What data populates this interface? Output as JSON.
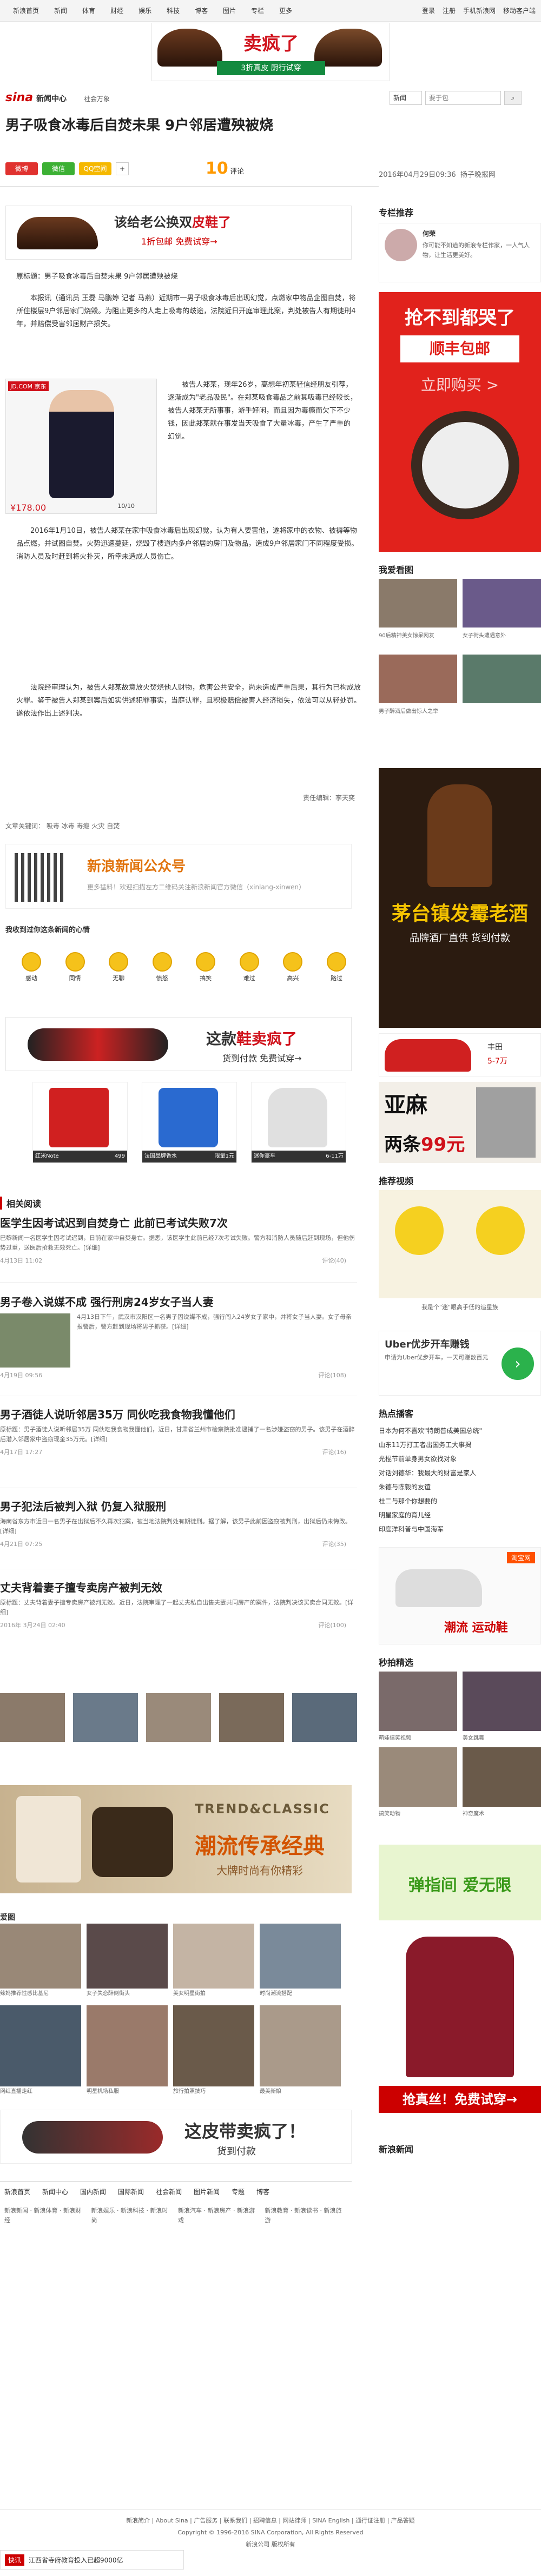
{
  "topnav": {
    "items": [
      "新浪首页",
      "新闻",
      "体育",
      "财经",
      "娱乐",
      "科技",
      "博客",
      "图片",
      "专栏",
      "更多"
    ],
    "right": [
      "登录",
      "注册",
      "手机新浪网",
      "移动客户端"
    ]
  },
  "top_ad": {
    "headline": "卖疯了",
    "sub": "3折真皮 厨行试穿"
  },
  "header": {
    "logo": "sina新闻中心",
    "logo_sub": "新闻中心",
    "channel": "社会万象",
    "search_select": "新闻",
    "search_placeholder": "要于包"
  },
  "article": {
    "title": "男子吸食冰毒后自焚未果 9户邻居遭殃被烧",
    "share_buttons": [
      "微博",
      "微信",
      "QQ空间"
    ],
    "comment_count": "10",
    "comment_label": "评论",
    "date": "2016年04月29日09:36",
    "source": "扬子晚报网",
    "ad": {
      "headline_pre": "该给老公换双",
      "headline_hl": "皮鞋了",
      "sub": "1折包邮 免费试穿→"
    },
    "paragraphs": [
      "原标题：男子吸食冰毒后自焚未果 9户邻居遭殃被烧",
      "本报讯（通讯员 王磊 马鹏婷 记者 马燕）近期市一男子吸食冰毒后出现幻觉，点燃家中物品企图自焚，将所住楼层9户邻居家门烧毁。为阻止更多的人走上吸毒的歧途，法院近日开庭审理此案，判处被告人有期徒刑4年，并赔偿受害邻居财产损失。",
      "被告人郑某，现年26岁，高想年初某轻信经朋友引荐，逐渐成为\"老品吸民\"。在郑某吸食毒品之前其吸毒已经较长，被告人郑某无所事事，游手好闲，而且因为毒瘾而欠下不少钱，因此郑某就在事发当天吸食了大量冰毒，产生了严重的幻觉。",
      "2016年1月10日，被告人郑某在家中吸食冰毒后出现幻觉，认为有人要害他，遂将家中的衣物、被褥等物品点燃，并试图自焚。火势迅速蔓延，烧毁了楼道内多户邻居的房门及物品，造成9户邻居家门不同程度受损。消防人员及时赶到将火扑灭，所幸未造成人员伤亡。",
      "法院经审理认为，被告人郑某故意放火焚烧他人财物，危害公共安全，尚未造成严重后果，其行为已构成放火罪。鉴于被告人郑某到案后如实供述犯罪事实，当庭认罪，且积极赔偿被害人经济损失，依法可以从轻处罚。遂依法作出上述判决。"
    ],
    "jd_ad": {
      "label": "JD.COM 京东",
      "price": "¥178.00",
      "page": "10/10"
    },
    "editor": "责任编辑：李天奕",
    "tags_label": "文章关键词：",
    "tags": [
      "吸毒",
      "冰毒",
      "毒瘾",
      "火灾",
      "自焚"
    ]
  },
  "wechat": {
    "title": "新浪新闻公众号",
    "desc": "更多猛料！欢迎扫描左方二维码关注新浪新闻官方微信（xinlang-xinwen）"
  },
  "mood": {
    "title": "我收到过你这条新闻的心情",
    "items": [
      "感动",
      "同情",
      "无聊",
      "愤怒",
      "搞笑",
      "难过",
      "高兴",
      "路过"
    ]
  },
  "shoe_ad": {
    "headline_pre": "这款",
    "headline_hl": "鞋卖疯了",
    "sub": "货到付款 免费试穿→"
  },
  "products": [
    {
      "name": "红米Note",
      "price": "499"
    },
    {
      "name": "法国品牌香水",
      "price": "限量1元"
    },
    {
      "name": "迷你豪车",
      "price": "6-11万"
    }
  ],
  "related": {
    "title": "相关阅读",
    "items": [
      {
        "headline": "医学生因考试迟到自焚身亡 此前已考试失败7次",
        "summary": "巴黎新闻一名医学生因考试迟到，日前在家中自焚身亡。据悉，该医学生此前已经7次考试失败。警方和消防人员随后赶到现场，但他伤势过重，送医后抢救无效死亡。[详细]",
        "time": "4月13日 11:02",
        "comments": "评论(40)"
      },
      {
        "headline": "男子卷入说媒不成 强行刑房24岁女子当人妻",
        "summary": "4月13日下午，武汉市汉阳区一名男子因说媒不成，强行闯入24岁女子家中，并将女子当人妻。女子母亲报警后，警方赶到现场将男子抓获。[详细]",
        "time": "4月19日 09:56",
        "comments": "评论(108)"
      },
      {
        "headline": "男子酒徒人说听邻居35万 同伙吃我食物我懂他们",
        "summary": "原标题：男子酒徒人说听邻居35万 同伙吃我食物我懂他们，近日，甘肃省兰州市检察院批准逮捕了一名涉嫌盗窃的男子。该男子在酒醉后潜入邻居家中盗窃现金35万元。[详细]",
        "time": "4月17日 17:27",
        "comments": "评论(16)"
      },
      {
        "headline": "男子犯法后被判入狱 仍复入狱服刑",
        "summary": "海南省东方市近日一名男子在出狱后不久再次犯案，被当地法院判处有期徒刑。据了解，该男子此前因盗窃被判刑，出狱后仍未悔改。[详细]",
        "time": "4月21日 07:25",
        "comments": "评论(35)"
      },
      {
        "headline": "丈夫背着妻子擅专卖房产被判无效",
        "summary": "原标题：丈夫背着妻子擅专卖房产被判无效。近日，法院审理了一起丈夫私自出售夫妻共同房产的案件，法院判决该买卖合同无效。[详细]",
        "time": "2016年 3月24日 02:40",
        "comments": "评论(100)"
      }
    ]
  },
  "fashion_ad": {
    "line1": "TREND&CLASSIC",
    "line2": "潮流传承经典",
    "line3": "大牌时尚有你精彩"
  },
  "gallery": {
    "title": "爱图",
    "captions": [
      "辣妈推荐性感比基尼",
      "女子失恋醉倒街头",
      "美女明星街拍",
      "时尚潮流搭配",
      "网红直播走红",
      "明星机场私服",
      "旅行拍照技巧",
      "最美新娘"
    ]
  },
  "shoe_ad2": {
    "headline": "这皮带卖疯了！",
    "sub": "货到付款"
  },
  "footer_links": {
    "tabs": [
      "新浪首页",
      "新闻中心",
      "国内新闻",
      "国际新闻",
      "社会新闻",
      "图片新闻",
      "专题",
      "博客"
    ],
    "cols": [
      "新浪新闻 · 新浪体育 · 新浪财经",
      "新浪娱乐 · 新浪科技 · 新浪时尚",
      "新浪汽车 · 新浪房产 · 新浪游戏",
      "新浪教育 · 新浪读书 · 新浪旅游"
    ]
  },
  "sidebar": {
    "column_title": "专栏推荐",
    "column_author": "何荣",
    "column_desc": "你可能不知道的新浪专栏作家，一人气人物，让生活更美好。",
    "ad1": {
      "t": "抢不到都哭了",
      "b": "顺丰包邮",
      "c": "立即购买 >"
    },
    "watch_title": "我爱看图",
    "watch_caption": [
      "90后精神美女惊呆网友",
      "女子街头遭遇意外",
      "男子醉酒后做出惊人之举"
    ],
    "ad2": {
      "t": "茅台镇发霉老酒",
      "s": "品牌酒厂直供 货到付款"
    },
    "car_ad": {
      "name": "丰田",
      "price": "5-7万"
    },
    "ad3": {
      "t": "亚麻",
      "s_pre": "两条",
      "s_hl": "99元"
    },
    "video_title": "推荐视频",
    "video_caption": "我是个\"迷\"眼高手低的追星族",
    "uber": {
      "t": "Uber优步开车赚钱",
      "s": "申请为Uber优步开车，一天可赚数百元"
    },
    "hot_title": "热点播客",
    "hot_list": [
      "日本为何不喜欢\"特朗普成美国总统\"",
      "山东11万打工者出国务工大事揭",
      "光棍节前单身男女欲找对象",
      "对话刘德华：我最大的财富是家人",
      "朱德与陈毅的友谊",
      "杜二与那个你想要的",
      "明星家庭的育儿经",
      "印度洋科普与中国海军"
    ],
    "taobao": {
      "label": "淘宝网",
      "sub": "潮流 运动鞋"
    },
    "pick_title": "秒拍精选",
    "pick_captions": [
      "萌娃搞笑视频",
      "美女跳舞",
      "搞笑动物",
      "神奇魔术"
    ],
    "ad4": {
      "t": "弹指间 爱无限"
    },
    "ad5": {
      "t": "抢真丝！免费试穿→"
    },
    "news_title": "新浪新闻"
  },
  "footer": {
    "links": [
      "新浪简介",
      "About Sina",
      "广告服务",
      "联系我们",
      "招聘信息",
      "网站律师",
      "SINA English",
      "通行证注册",
      "产品答疑"
    ],
    "copyright": "Copyright © 1996-2016 SINA Corporation, All Rights Reserved",
    "company": "新浪公司 版权所有"
  },
  "fixed_bar": {
    "label": "快讯",
    "text": "江西省寺府教育投入已超9000亿"
  }
}
